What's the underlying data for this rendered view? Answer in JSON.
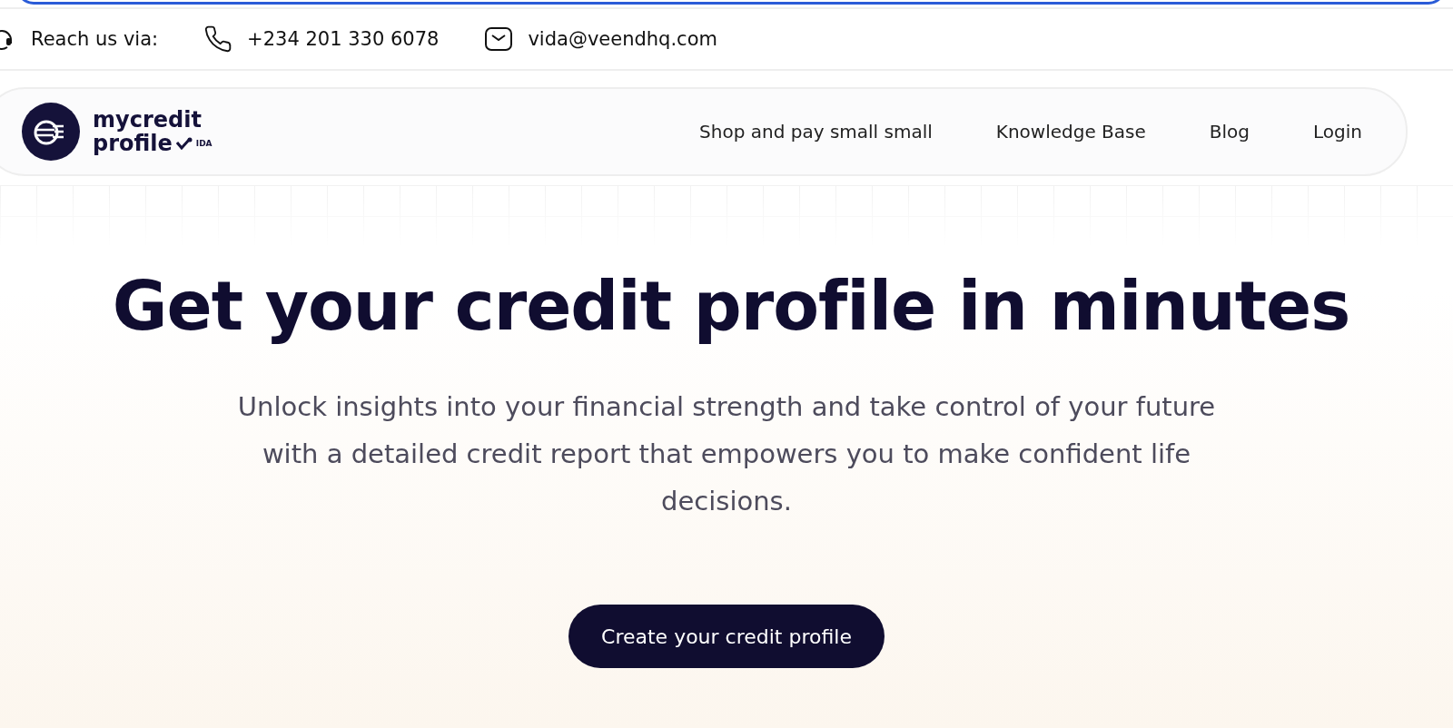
{
  "contact_bar": {
    "label": "Reach us via:",
    "phone": "+234 201 330 6078",
    "email": "vida@veendhq.com"
  },
  "nav": {
    "logo": {
      "line1": "mycredit",
      "line2": "profile",
      "badge": "IDA"
    },
    "links": [
      {
        "label": "Shop and pay small small"
      },
      {
        "label": "Knowledge Base"
      },
      {
        "label": "Blog"
      },
      {
        "label": "Login"
      }
    ]
  },
  "hero": {
    "title": "Get your credit profile in minutes",
    "subtitle": "Unlock insights into your financial strength and take control of your future with a detailed credit report that empowers you to make confident life decisions.",
    "cta": "Create your credit profile"
  }
}
